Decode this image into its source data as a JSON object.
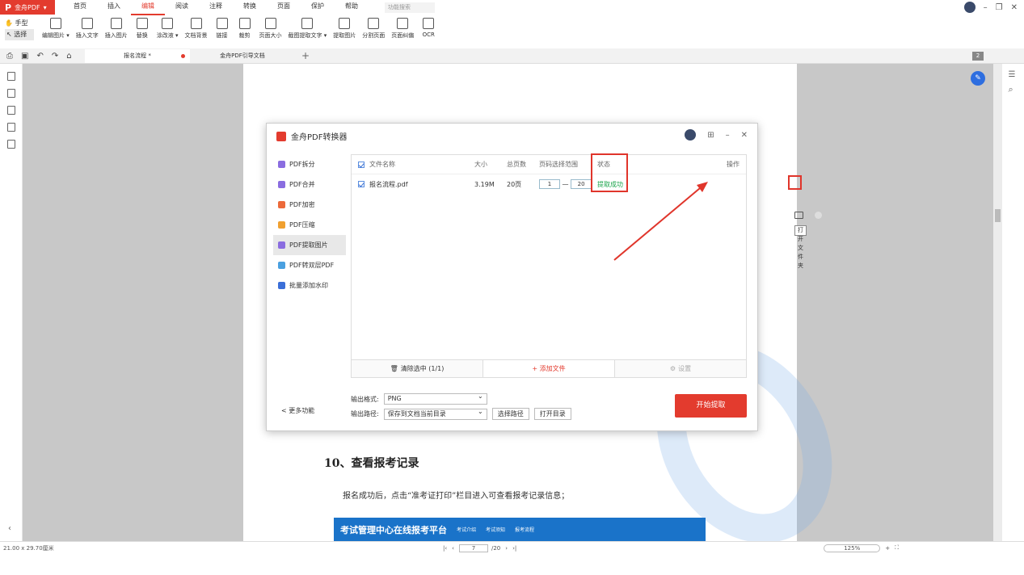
{
  "app": {
    "name": "金舟PDF",
    "dropdown": "▾"
  },
  "menu": {
    "items": [
      "首页",
      "插入",
      "编辑",
      "阅读",
      "注释",
      "转换",
      "页面",
      "保护",
      "帮助"
    ],
    "active_index": 2,
    "search_placeholder": "功能搜索"
  },
  "toolbar": {
    "mode": {
      "hand": "手型",
      "select": "选择"
    },
    "tools": [
      "编辑图片 ▾",
      "插入文字",
      "插入图片",
      "替换",
      "涂改液 ▾",
      "文档背景",
      "链接",
      "裁剪",
      "页面大小",
      "截图提取文字 ▾",
      "提取图片",
      "分割页面",
      "页面纠偏",
      "OCR"
    ]
  },
  "tabs": [
    {
      "label": "报名流程 *",
      "modified": true
    },
    {
      "label": "金舟PDF引导文档"
    }
  ],
  "tab_add": "+",
  "page_badge": "2",
  "document": {
    "heading": "10、查看报考记录",
    "paragraph": "报名成功后，点击“准考证打印”栏目进入可查看报考记录信息；",
    "banner": {
      "title": "考试管理中心在线报考平台",
      "links": [
        "考试介绍",
        "考试须知",
        "报考流程"
      ]
    }
  },
  "dialog": {
    "title": "金舟PDF转换器",
    "sidebar": [
      {
        "label": "PDF拆分",
        "color": "#8a6de0"
      },
      {
        "label": "PDF合并",
        "color": "#8a6de0"
      },
      {
        "label": "PDF加密",
        "color": "#ec6a3a"
      },
      {
        "label": "PDF压缩",
        "color": "#f0a030"
      },
      {
        "label": "PDF提取图片",
        "color": "#8a6de0",
        "active": true
      },
      {
        "label": "PDF转双层PDF",
        "color": "#4aa0e0"
      },
      {
        "label": "批量添加水印",
        "color": "#3b6fd8"
      }
    ],
    "more": "< 更多功能",
    "table": {
      "headers": [
        "文件名称",
        "大小",
        "总页数",
        "页码选择范围",
        "状态",
        "操作"
      ],
      "rows": [
        {
          "name": "报名流程.pdf",
          "size": "3.19M",
          "pages": "20页",
          "from": "1",
          "sep": "—",
          "to": "20",
          "status": "提取成功"
        }
      ]
    },
    "tooltip": "打开文件夹",
    "footer": {
      "clear": "清除选中 (1/1)",
      "add": "+ 添加文件",
      "settings": "设置"
    },
    "output": {
      "format_label": "输出格式:",
      "format_value": "PNG",
      "path_label": "输出路径:",
      "path_value": "保存到文档当前目录",
      "choose_path": "选择路径",
      "open_dir": "打开目录"
    },
    "start": "开始提取"
  },
  "status": {
    "page_size": "21.00 x 29.70厘米",
    "page_current": "7",
    "page_total": "/20",
    "zoom": "125%"
  },
  "colors": {
    "brand": "#e33b2e",
    "success": "#19a44a",
    "highlight": "#e0352b"
  }
}
